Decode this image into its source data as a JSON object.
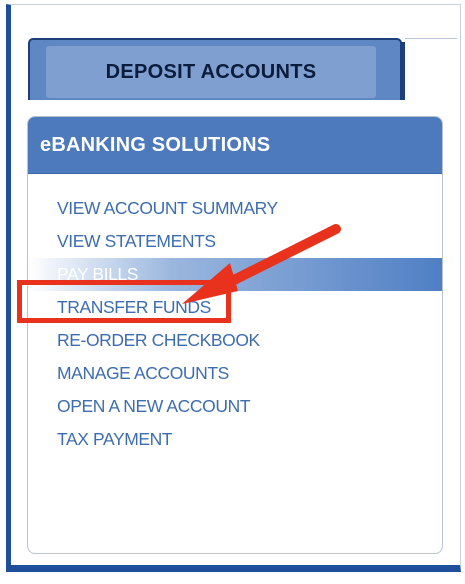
{
  "tabs": {
    "active_label": "DEPOSIT ACCOUNTS"
  },
  "panel": {
    "header": "eBANKING SOLUTIONS",
    "items": [
      {
        "label": "VIEW ACCOUNT SUMMARY"
      },
      {
        "label": "VIEW STATEMENTS"
      },
      {
        "label": "PAY BILLS"
      },
      {
        "label": "TRANSFER FUNDS"
      },
      {
        "label": "RE-ORDER CHECKBOOK"
      },
      {
        "label": "MANAGE ACCOUNTS"
      },
      {
        "label": "OPEN A NEW ACCOUNT"
      },
      {
        "label": "TAX PAYMENT"
      }
    ],
    "active_item": "PAY BILLS"
  },
  "annotations": {
    "highlight_color": "#e8321e",
    "arrow_icon": "red-arrow-icon"
  },
  "colors": {
    "tab_blue": "#5f87c4",
    "header_blue": "#4d79bd",
    "link_blue": "#3d6daf",
    "frame_blue": "#1f4f9a"
  }
}
